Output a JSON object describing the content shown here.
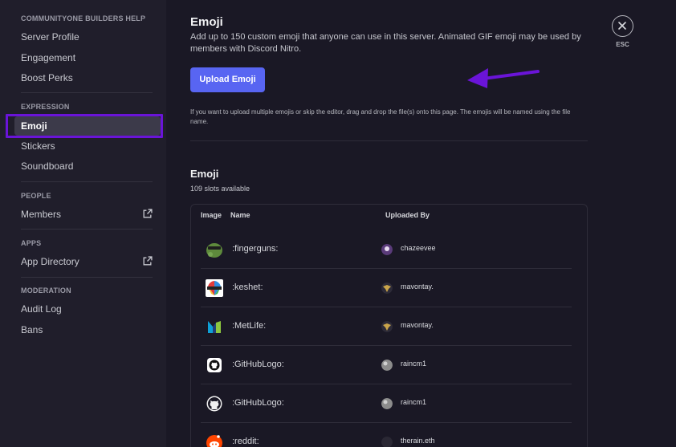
{
  "sidebar": {
    "sections": [
      {
        "header": "COMMUNITYONE BUILDERS HELP",
        "items": [
          "Server Profile",
          "Engagement",
          "Boost Perks"
        ]
      },
      {
        "header": "EXPRESSION",
        "items": [
          "Emoji",
          "Stickers",
          "Soundboard"
        ]
      },
      {
        "header": "PEOPLE",
        "items": [
          "Members"
        ]
      },
      {
        "header": "APPS",
        "items": [
          "App Directory"
        ]
      },
      {
        "header": "MODERATION",
        "items": [
          "Audit Log",
          "Bans"
        ]
      }
    ],
    "selected": "Emoji"
  },
  "main": {
    "title": "Emoji",
    "description": "Add up to 150 custom emoji that anyone can use in this server. Animated GIF emoji may be used by members with Discord Nitro.",
    "upload_label": "Upload Emoji",
    "note": "If you want to upload multiple emojis or skip the editor, drag and drop the file(s) onto this page. The emojis will be named using the file name.",
    "list_title": "Emoji",
    "slots": "109 slots available",
    "columns": {
      "image": "Image",
      "name": "Name",
      "uploaded_by": "Uploaded By"
    },
    "rows": [
      {
        "name": ":fingerguns:",
        "uploader": "chazeevee",
        "icon": "fingerguns-emoji"
      },
      {
        "name": ":keshet:",
        "uploader": "mavontay.",
        "icon": "keshet-emoji"
      },
      {
        "name": ":MetLife:",
        "uploader": "mavontay.",
        "icon": "metlife-emoji"
      },
      {
        "name": ":GitHubLogo:",
        "uploader": "raincm1",
        "icon": "github-emoji"
      },
      {
        "name": ":GitHubLogo:",
        "uploader": "raincm1",
        "icon": "github-emoji"
      },
      {
        "name": ":reddit:",
        "uploader": "therain.eth",
        "icon": "reddit-emoji"
      }
    ]
  },
  "close": {
    "esc_label": "ESC"
  },
  "colors": {
    "accent": "#5865f2",
    "highlight": "#6a14d8",
    "background": "#1a1825",
    "sidebar": "#201e2b"
  }
}
